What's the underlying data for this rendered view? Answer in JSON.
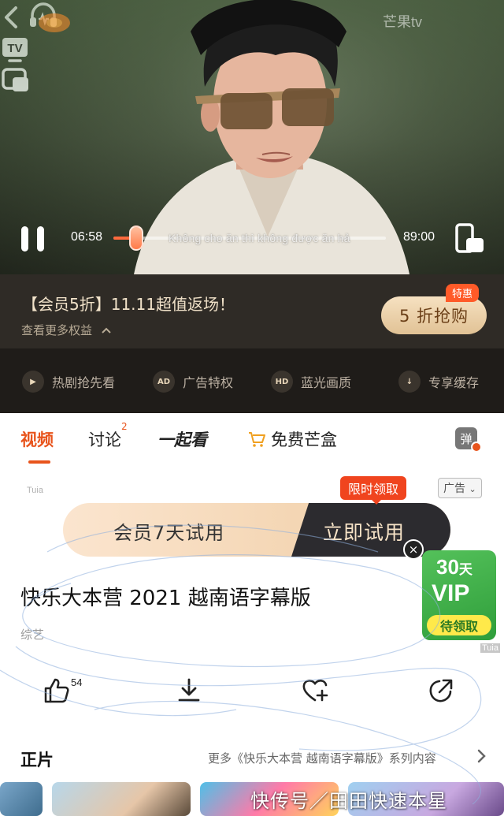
{
  "player": {
    "time_current": "06:58",
    "time_total": "89:00",
    "progress": 0.078,
    "subtitle": "Không cho ăn thì không được ăn hả",
    "brand_watermark": "芒果tv",
    "icons": [
      "back-icon",
      "headphone-icon",
      "tv-icon",
      "pip-icon",
      "pause-icon",
      "rotate-screen-icon"
    ],
    "tv_label": "TV"
  },
  "promo": {
    "title": "【会员5折】11.11超值返场！",
    "more": "查看更多权益",
    "cta": "5 折抢购",
    "badge": "特惠"
  },
  "benefits": [
    {
      "icon": "play-icon",
      "glyph": "▶",
      "label": "热剧抢先看"
    },
    {
      "icon": "ad-icon",
      "glyph": "AD",
      "label": "广告特权"
    },
    {
      "icon": "hd-icon",
      "glyph": "HD",
      "label": "蓝光画质"
    },
    {
      "icon": "download-icon",
      "glyph": "↓",
      "label": "专享缓存"
    }
  ],
  "tabs": {
    "video": "视频",
    "discuss": "讨论",
    "discuss_count": "2",
    "watch_together": "一起看",
    "mango_box": "免费芒盒",
    "danmaku": "弹"
  },
  "ad": {
    "source": "Tuia",
    "label": "广告",
    "limited": "限时领取",
    "left_text": "会员7天试用",
    "right_text": "立即试用",
    "close": "×"
  },
  "vip_widget": {
    "days": "30",
    "days_unit": "天",
    "word": "VIP",
    "claim": "待领取",
    "source": "Tuia"
  },
  "show": {
    "title": "快乐大本营 2021 越南语字幕版",
    "genre": "综艺"
  },
  "actions": {
    "like_count": "54",
    "icons": [
      "like-icon",
      "download-icon",
      "favorite-add-icon",
      "share-icon"
    ]
  },
  "section": {
    "title": "正片",
    "more": "更多《快乐大本营 越南语字幕版》系列内容"
  },
  "watermark": "快传号／田田快速本星",
  "colors": {
    "accent": "#e8541c",
    "promo_bg": "#2f2b26",
    "benefit_bg": "#1f1c19",
    "cta_gold": "#e9cda5",
    "vip_green": "#3aaa44"
  }
}
